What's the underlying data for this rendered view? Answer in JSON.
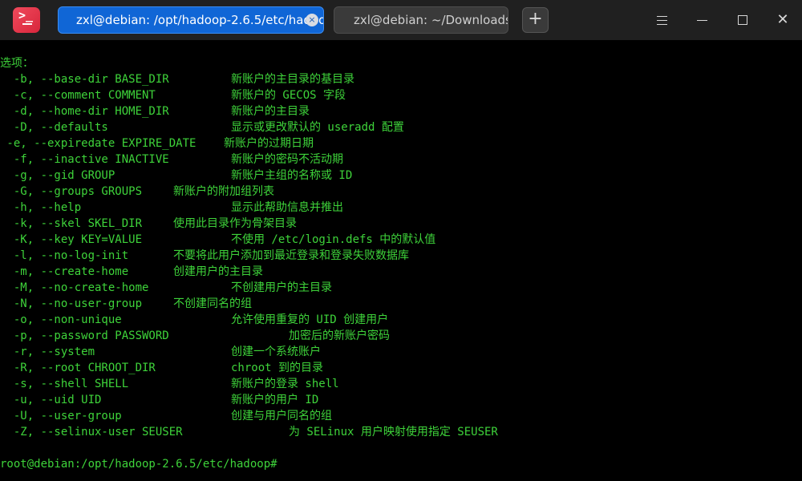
{
  "titlebar": {
    "tabs": [
      {
        "label": "zxl@debian: /opt/hadoop-2.6.5/etc/hadoop",
        "active": true
      },
      {
        "label": "zxl@debian: ~/Downloads",
        "active": false
      }
    ],
    "app_icon_glyph": ">_",
    "add_tab_glyph": "+",
    "close_tab_glyph": "×",
    "window_icons": [
      "menu-icon",
      "minimize-icon",
      "maximize-icon",
      "close-icon"
    ]
  },
  "terminal": {
    "text_color": "#3ed33a",
    "background": "#000000",
    "options_header": "选项：",
    "options": [
      {
        "flag": "  -b, --base-dir BASE_DIR",
        "desc": "新账户的主目录的基目录"
      },
      {
        "flag": "  -c, --comment COMMENT",
        "desc": "新账户的 GECOS 字段"
      },
      {
        "flag": "  -d, --home-dir HOME_DIR",
        "desc": "新账户的主目录"
      },
      {
        "flag": "  -D, --defaults",
        "desc": "显示或更改默认的 useradd 配置"
      },
      {
        "flag": " -e, --expiredate EXPIRE_DATE",
        "desc": "新账户的过期日期"
      },
      {
        "flag": "  -f, --inactive INACTIVE",
        "desc": "新账户的密码不活动期"
      },
      {
        "flag": "  -g, --gid GROUP",
        "desc": "新账户主组的名称或 ID"
      },
      {
        "flag": "  -G, --groups GROUPS",
        "desc": "新账户的附加组列表"
      },
      {
        "flag": "  -h, --help",
        "desc": "显示此帮助信息并推出"
      },
      {
        "flag": "  -k, --skel SKEL_DIR",
        "desc": "使用此目录作为骨架目录"
      },
      {
        "flag": "  -K, --key KEY=VALUE",
        "desc": "不使用 /etc/login.defs 中的默认值"
      },
      {
        "flag": "  -l, --no-log-init",
        "desc": "不要将此用户添加到最近登录和登录失败数据库"
      },
      {
        "flag": "  -m, --create-home",
        "desc": "创建用户的主目录"
      },
      {
        "flag": "  -M, --no-create-home",
        "desc": "不创建用户的主目录"
      },
      {
        "flag": "  -N, --no-user-group",
        "desc": "不创建同名的组"
      },
      {
        "flag": "  -o, --non-unique",
        "desc": "允许使用重复的 UID 创建用户"
      },
      {
        "flag": "  -p, --password PASSWORD",
        "desc": "加密后的新账户密码"
      },
      {
        "flag": "  -r, --system",
        "desc": "创建一个系统账户"
      },
      {
        "flag": "  -R, --root CHROOT_DIR",
        "desc": "chroot 到的目录"
      },
      {
        "flag": "  -s, --shell SHELL",
        "desc": "新账户的登录 shell"
      },
      {
        "flag": "  -u, --uid UID",
        "desc": "新账户的用户 ID"
      },
      {
        "flag": "  -U, --user-group",
        "desc": "创建与用户同名的组"
      },
      {
        "flag": "  -Z, --selinux-user SEUSER",
        "desc": "为 SELinux 用户映射使用指定 SEUSER"
      }
    ],
    "prompt": "root@debian:/opt/hadoop-2.6.5/etc/hadoop#"
  }
}
